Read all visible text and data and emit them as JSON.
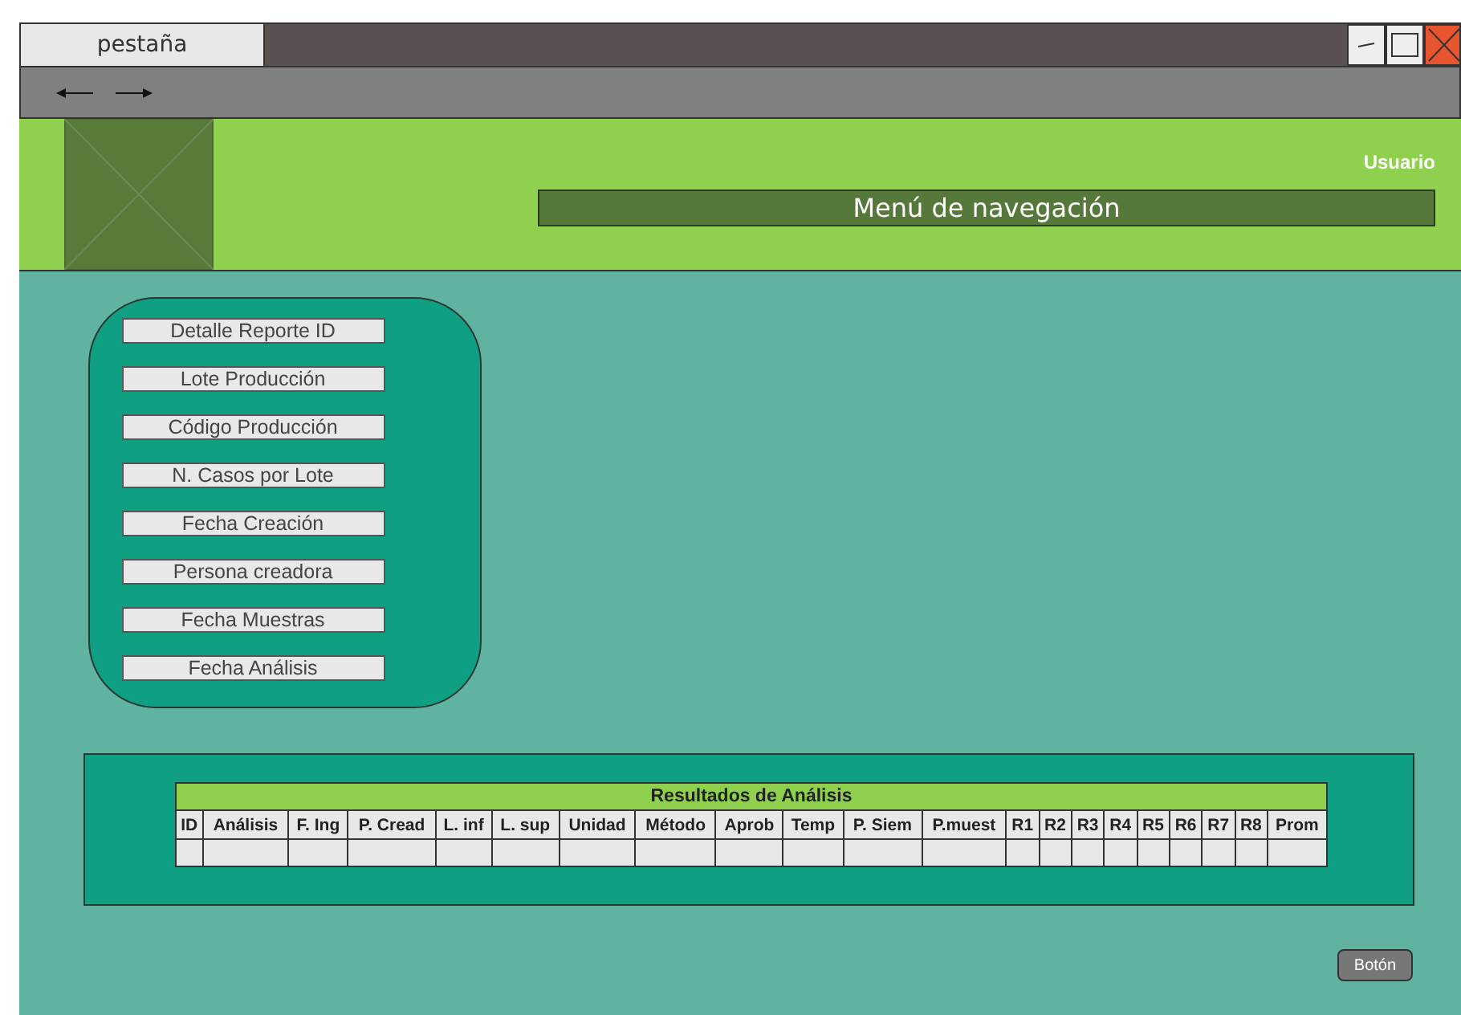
{
  "window": {
    "tab": "pestaña"
  },
  "header": {
    "user": "Usuario",
    "nav": "Menú de navegación"
  },
  "menu": {
    "items": [
      "Detalle Reporte ID",
      "Lote Producción",
      "Código Producción",
      "N. Casos por Lote",
      "Fecha Creación",
      "Persona creadora",
      "Fecha Muestras",
      "Fecha Análisis"
    ]
  },
  "results": {
    "title": "Resultados de Análisis",
    "columns": [
      "ID",
      "Análisis",
      "F. Ing",
      "P. Cread",
      "L. inf",
      "L. sup",
      "Unidad",
      "Método",
      "Aprob",
      "Temp",
      "P. Siem",
      "P.muest",
      "R1",
      "R2",
      "R3",
      "R4",
      "R5",
      "R6",
      "R7",
      "R8",
      "Prom"
    ]
  },
  "button": "Botón"
}
